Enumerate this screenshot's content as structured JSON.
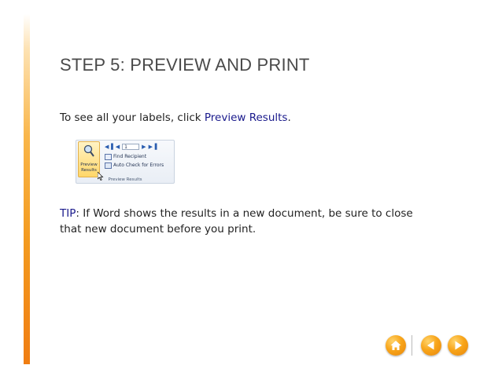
{
  "slide": {
    "title": "STEP 5: PREVIEW AND PRINT",
    "instruction_prefix": "To see all your labels, click ",
    "instruction_link": "Preview Results",
    "instruction_suffix": ".",
    "tip_label": "TIP",
    "tip_text": ": If Word shows the results in a new document, be sure to close that new document before you print."
  },
  "ribbon": {
    "preview_line1": "Preview",
    "preview_line2": "Results",
    "record_value": "1",
    "find_recipient": "Find Recipient",
    "auto_check": "Auto Check for Errors",
    "group_label": "Preview Results"
  },
  "nav": {
    "home_icon": "home-icon",
    "prev_icon": "arrow-left-icon",
    "next_icon": "arrow-right-icon"
  },
  "colors": {
    "accent": "#f39a1f",
    "link": "#1a1a8c",
    "title": "#4a4a4a"
  }
}
